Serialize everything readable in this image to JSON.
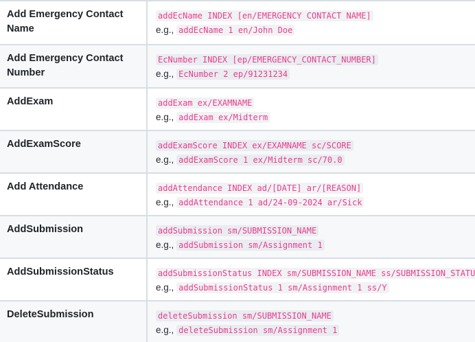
{
  "rows": [
    {
      "action": "Add Emergency Contact Name",
      "format": "addEcName INDEX [en/EMERGENCY CONTACT NAME]",
      "example_prefix": "e.g.,",
      "example": "addEcName 1 en/John Doe"
    },
    {
      "action": "Add Emergency Contact Number",
      "format": "EcNumber INDEX [ep/EMERGENCY_CONTACT_NUMBER]",
      "example_prefix": "e.g.,",
      "example": "EcNumber 2 ep/91231234"
    },
    {
      "action": "AddExam",
      "format": "addExam ex/EXAMNAME",
      "example_prefix": "e.g.,",
      "example": "addExam ex/Midterm"
    },
    {
      "action": "AddExamScore",
      "format": "addExamScore INDEX ex/EXAMNAME sc/SCORE",
      "example_prefix": "e.g.,",
      "example": "addExamScore 1 ex/Midterm sc/70.0"
    },
    {
      "action": "Add Attendance",
      "format": "addAttendance INDEX ad/[DATE] ar/[REASON]",
      "example_prefix": "e.g.,",
      "example": "addAttendance 1 ad/24-09-2024 ar/Sick"
    },
    {
      "action": "AddSubmission",
      "format": "addSubmission sm/SUBMISSION_NAME",
      "example_prefix": "e.g.,",
      "example": "addSubmission sm/Assignment 1"
    },
    {
      "action": "AddSubmissionStatus",
      "format": "addSubmissionStatus INDEX sm/SUBMISSION_NAME ss/SUBMISSION_STATUS",
      "example_prefix": "e.g.,",
      "example": "addSubmissionStatus 1 sm/Assignment 1 ss/Y"
    },
    {
      "action": "DeleteSubmission",
      "format": "deleteSubmission sm/SUBMISSION_NAME",
      "example_prefix": "e.g.,",
      "example": "deleteSubmission sm/Assignment 1"
    }
  ]
}
